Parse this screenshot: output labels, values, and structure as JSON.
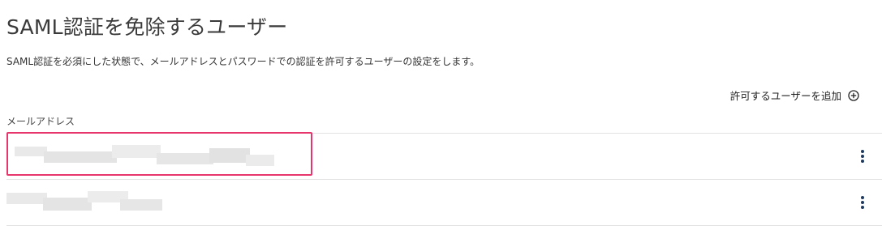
{
  "page": {
    "title": "SAML認証を免除するユーザー",
    "description": "SAML認証を必須にした状態で、メールアドレスとパスワードでの認証を許可するユーザーの設定をします。"
  },
  "toolbar": {
    "add_user_label": "許可するユーザーを追加",
    "add_icon": "plus-circle-icon"
  },
  "table": {
    "columns": [
      "メールアドレス"
    ],
    "rows": [
      {
        "email": "",
        "blurred": true,
        "highlighted": true,
        "menu_icon": "more-vertical-icon"
      },
      {
        "email": "",
        "blurred": true,
        "highlighted": false,
        "menu_icon": "more-vertical-icon"
      }
    ]
  },
  "colors": {
    "highlight": "#e6366c",
    "kebab": "#1f3a5f",
    "divider": "#e2e2e2"
  }
}
